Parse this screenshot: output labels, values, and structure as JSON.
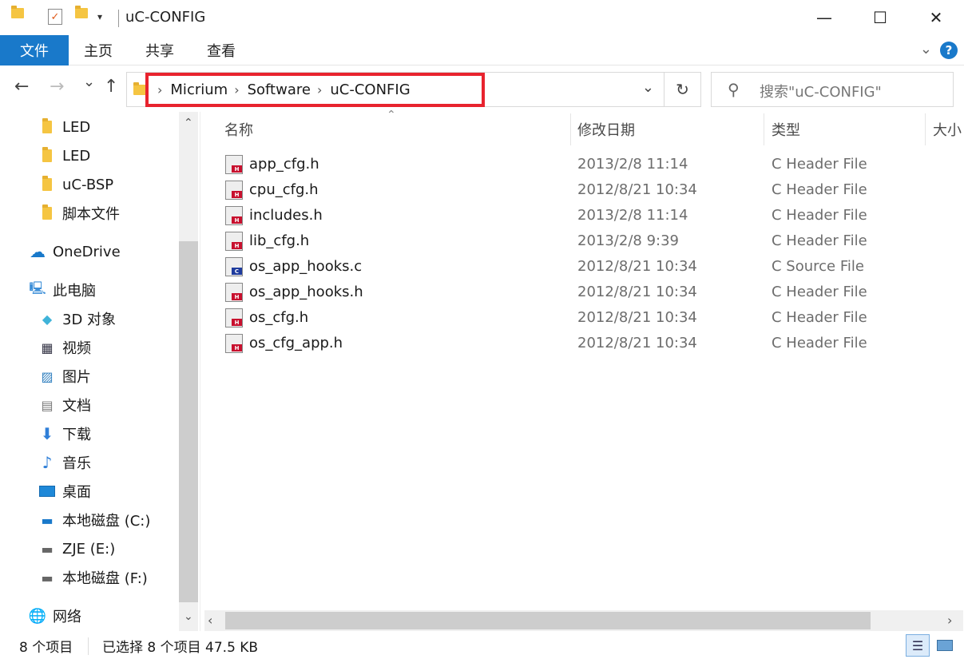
{
  "window": {
    "title": "uC-CONFIG",
    "minimize": "—",
    "maximize": "☐",
    "close": "✕"
  },
  "ribbon": {
    "tabs": [
      "文件",
      "主页",
      "共享",
      "查看"
    ],
    "help": "?"
  },
  "nav": {
    "back": "←",
    "forward": "→",
    "recent": "⌄",
    "up": "↑",
    "breadcrumb": [
      "Micrium",
      "Software",
      "uC-CONFIG"
    ],
    "search_placeholder": "搜索\"uC-CONFIG\""
  },
  "sidebar": {
    "items": [
      {
        "label": "LED",
        "icon": "folder-icon"
      },
      {
        "label": "LED",
        "icon": "folder-icon"
      },
      {
        "label": "uC-BSP",
        "icon": "folder-icon"
      },
      {
        "label": "脚本文件",
        "icon": "folder-icon"
      },
      {
        "label": "OneDrive",
        "icon": "cloud-icon"
      },
      {
        "label": "此电脑",
        "icon": "computer-icon"
      },
      {
        "label": "3D 对象",
        "icon": "cube-icon"
      },
      {
        "label": "视频",
        "icon": "video-icon"
      },
      {
        "label": "图片",
        "icon": "picture-icon"
      },
      {
        "label": "文档",
        "icon": "document-icon"
      },
      {
        "label": "下载",
        "icon": "download-icon"
      },
      {
        "label": "音乐",
        "icon": "music-icon"
      },
      {
        "label": "桌面",
        "icon": "desktop-icon"
      },
      {
        "label": "本地磁盘 (C:)",
        "icon": "drive-windows-icon"
      },
      {
        "label": "ZJE (E:)",
        "icon": "drive-icon"
      },
      {
        "label": "本地磁盘 (F:)",
        "icon": "drive-icon"
      },
      {
        "label": "网络",
        "icon": "network-icon"
      }
    ]
  },
  "columns": {
    "name": "名称",
    "date": "修改日期",
    "type": "类型",
    "size": "大小"
  },
  "files": [
    {
      "name": "app_cfg.h",
      "date": "2013/2/8 11:14",
      "type": "C Header File",
      "kind": "H"
    },
    {
      "name": "cpu_cfg.h",
      "date": "2012/8/21 10:34",
      "type": "C Header File",
      "kind": "H"
    },
    {
      "name": "includes.h",
      "date": "2013/2/8 11:14",
      "type": "C Header File",
      "kind": "H"
    },
    {
      "name": "lib_cfg.h",
      "date": "2013/2/8 9:39",
      "type": "C Header File",
      "kind": "H"
    },
    {
      "name": "os_app_hooks.c",
      "date": "2012/8/21 10:34",
      "type": "C Source File",
      "kind": "C"
    },
    {
      "name": "os_app_hooks.h",
      "date": "2012/8/21 10:34",
      "type": "C Header File",
      "kind": "H"
    },
    {
      "name": "os_cfg.h",
      "date": "2012/8/21 10:34",
      "type": "C Header File",
      "kind": "H"
    },
    {
      "name": "os_cfg_app.h",
      "date": "2012/8/21 10:34",
      "type": "C Header File",
      "kind": "H"
    }
  ],
  "status": {
    "count": "8 个项目",
    "selected": "已选择 8 个项目  47.5 KB"
  },
  "colors": {
    "accent": "#1979ca",
    "highlight": "#e8232e",
    "header_badge": "#c8102e",
    "source_badge": "#1f3c9e"
  }
}
